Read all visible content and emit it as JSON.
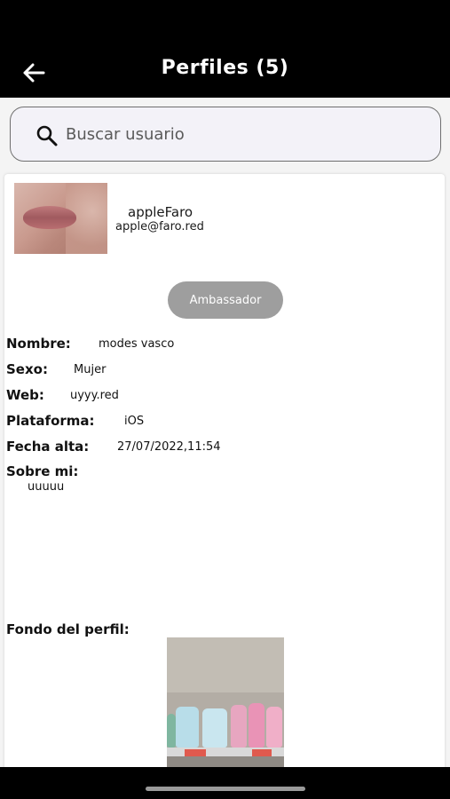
{
  "header": {
    "title": "Perfiles (5)",
    "back_icon": "arrow-left-icon"
  },
  "search": {
    "placeholder": "Buscar usuario",
    "value": "",
    "icon": "search-icon"
  },
  "profile": {
    "username": "appleFaro",
    "email": "apple@faro.red",
    "badge": "Ambassador",
    "fields": {
      "nombre_label": "Nombre:",
      "nombre_value": "modes vasco",
      "sexo_label": "Sexo:",
      "sexo_value": "Mujer",
      "web_label": "Web:",
      "web_value": "uyyy.red",
      "plataforma_label": "Plataforma:",
      "plataforma_value": "iOS",
      "fecha_label": "Fecha alta:",
      "fecha_value": "27/07/2022,11:54",
      "sobre_label": "Sobre mi:",
      "sobre_value": "uuuuu",
      "fondo_label": "Fondo del perfil:"
    }
  },
  "colors": {
    "header_bg": "#000000",
    "badge_bg": "#9e9e9e",
    "search_bg": "#f3f2f8"
  }
}
